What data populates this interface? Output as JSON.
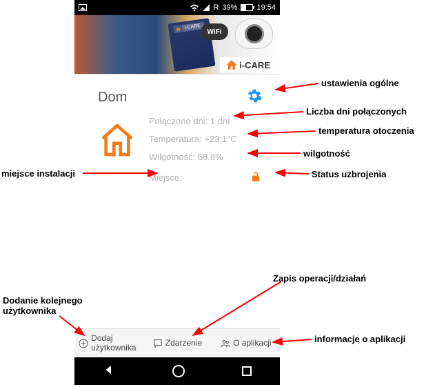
{
  "statusbar": {
    "signal_label": "R",
    "battery_pct": "39%",
    "time": "19:54"
  },
  "banner": {
    "wifi_label": "WiFi",
    "brand": "i-CARE",
    "mid_brand": "i-CARE"
  },
  "card": {
    "title": "Dom",
    "days_connected": "Połączono dni: 1 dni",
    "temperature": "Temperatura: +23.1°C",
    "humidity": "Wilgotność: 68.8%",
    "place_label": "Miejsce:"
  },
  "bottombar": {
    "add_user": "Dodaj użytkownika",
    "events": "Zdarzenie",
    "about": "O aplikacji"
  },
  "annotations": {
    "settings": "ustawienia ogólne",
    "days": "Liczba dni połączonych",
    "temperature": "temperatura otoczenia",
    "humidity": "wilgotność",
    "install_place": "miejsce instalacji",
    "arm_status": "Status uzbrojenia",
    "ops_log": "Zapis operacji/działań",
    "add_user": "Dodanie kolejnego użytkownika",
    "about": "informacje o aplikacji"
  },
  "colors": {
    "accent": "#ef7d1a",
    "gear": "#2196e8",
    "arrow": "#ff0000",
    "muted": "#b0b0b0"
  }
}
